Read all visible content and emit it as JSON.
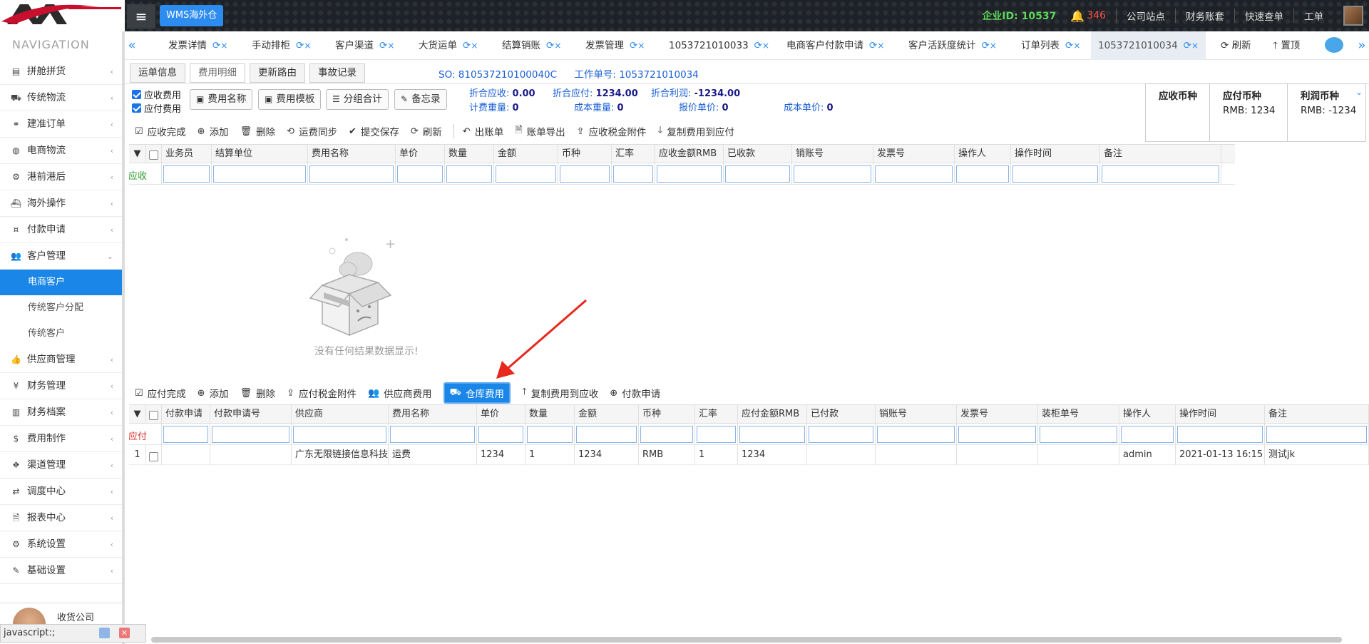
{
  "topbar": {
    "brand": "WMS海外仓",
    "corp_id_label": "企业ID:",
    "corp_id": "10537",
    "notif_count": "346",
    "links": [
      "公司站点",
      "财务账套",
      "快速查单",
      "工单"
    ]
  },
  "sidebar": {
    "title": "NAVIGATION",
    "items": [
      {
        "icon": "grid-icon",
        "label": "拼舱拼货"
      },
      {
        "icon": "truck-icon",
        "label": "传统物流"
      },
      {
        "icon": "link-icon",
        "label": "建准订单"
      },
      {
        "icon": "globe-icon",
        "label": "电商物流"
      },
      {
        "icon": "sitemap-icon",
        "label": "港前港后"
      },
      {
        "icon": "ship-icon",
        "label": "海外操作"
      },
      {
        "icon": "money-icon",
        "label": "付款申请"
      },
      {
        "icon": "users-icon",
        "label": "客户管理"
      }
    ],
    "sub_items": [
      "电商客户",
      "传统客户分配",
      "传统客户"
    ],
    "items2": [
      {
        "icon": "thumb-icon",
        "label": "供应商管理"
      },
      {
        "icon": "yen-icon",
        "label": "财务管理"
      },
      {
        "icon": "book-icon",
        "label": "财务档案"
      },
      {
        "icon": "dollar-icon",
        "label": "费用制作"
      },
      {
        "icon": "road-icon",
        "label": "渠道管理"
      },
      {
        "icon": "retweet-icon",
        "label": "调度中心"
      },
      {
        "icon": "file-icon",
        "label": "报表中心"
      },
      {
        "icon": "gear-icon",
        "label": "系统设置"
      },
      {
        "icon": "edit-icon",
        "label": "基础设置"
      }
    ],
    "user_name": "收货公司",
    "status_link": "javascript:;"
  },
  "tabs": [
    "发票详情",
    "手动排柜",
    "客户渠道",
    "大货运单",
    "结算销账",
    "发票管理",
    "1053721010033",
    "电商客户付款申请",
    "客户活跃度统计",
    "订单列表",
    "1053721010034"
  ],
  "tab_actions": {
    "refresh": "刷新",
    "top": "置顶"
  },
  "subtabs": [
    "运单信息",
    "费用明细",
    "更新路由",
    "事故记录"
  ],
  "so_info": {
    "so": "SO:  810537210100040C",
    "work": "工作单号: 1053721010034"
  },
  "filters": {
    "receivable": "应收费用",
    "payable": "应付费用",
    "buttons": [
      "费用名称",
      "费用模板",
      "分组合计",
      "备忘录"
    ]
  },
  "summary": {
    "recv_label": "折合应收:",
    "recv": "0.00",
    "pay_label": "折合应付:",
    "pay": "1234.00",
    "profit_label": "折合利润:",
    "profit": "-1234.00",
    "charge_weight_label": "计费重量:",
    "charge_weight": "0",
    "cost_weight_label": "成本重量:",
    "cost_weight": "0",
    "quote_price_label": "报价单价:",
    "quote_price": "0",
    "cost_price_label": "成本单价:",
    "cost_price": "0"
  },
  "currency": {
    "recv_head": "应收币种",
    "recv_val": "",
    "pay_head": "应付币种",
    "pay_val": "RMB:  1234",
    "profit_head": "利润币种",
    "profit_val": "RMB:  -1234"
  },
  "recv_toolbar": [
    "应收完成",
    "添加",
    "删除",
    "运费同步",
    "提交保存",
    "刷新",
    "出账单",
    "账单导出",
    "应收税金附件",
    "复制费用到应付"
  ],
  "recv_grid": {
    "row_label": "应收",
    "columns": [
      "业务员",
      "结算单位",
      "费用名称",
      "单价",
      "数量",
      "金额",
      "币种",
      "汇率",
      "应收金额RMB",
      "已收款",
      "销账号",
      "发票号",
      "操作人",
      "操作时间",
      "备注"
    ]
  },
  "empty_text": "没有任何结果数据显示!",
  "pay_toolbar": [
    "应付完成",
    "添加",
    "删除",
    "应付税金附件",
    "供应商费用",
    "仓库费用",
    "复制费用到应收",
    "付款申请"
  ],
  "pay_grid": {
    "row_label": "应付",
    "columns": [
      "付款申请",
      "付款申请号",
      "供应商",
      "费用名称",
      "单价",
      "数量",
      "金额",
      "币种",
      "汇率",
      "应付金额RMB",
      "已付款",
      "销账号",
      "发票号",
      "装柜单号",
      "操作人",
      "操作时间",
      "备注"
    ],
    "rows": [
      [
        "1",
        "",
        "",
        "广东无限链接信息科技",
        "运费",
        "1234",
        "1",
        "1234",
        "RMB",
        "1",
        "1234",
        "",
        "",
        "",
        "",
        "admin",
        "2021-01-13 16:15",
        "测试jk"
      ]
    ]
  }
}
